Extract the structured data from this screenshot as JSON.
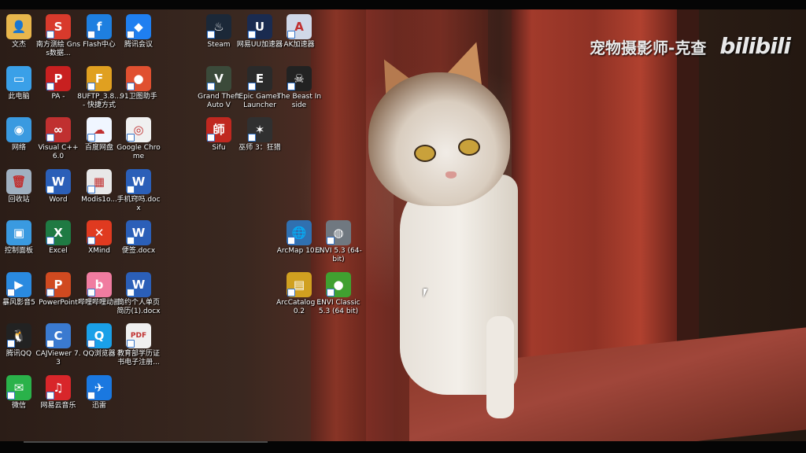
{
  "watermark": {
    "text": "宠物摄影师-克查",
    "logo": "bilibili"
  },
  "icons": [
    {
      "id": "wenjian",
      "label": "文杰",
      "color": "#e8b64c",
      "glyph": "👤",
      "col": 0,
      "row": 0,
      "shortcut": false
    },
    {
      "id": "nanfang",
      "label": "南方测绘 Gnss数据...",
      "color": "#d83a2c",
      "glyph": "S",
      "col": 1,
      "row": 0
    },
    {
      "id": "flash",
      "label": "Flash中心",
      "color": "#1e7fe0",
      "glyph": "f",
      "col": 2,
      "row": 0
    },
    {
      "id": "tengxunhuiyi",
      "label": "腾讯会议",
      "color": "#1f7ff0",
      "glyph": "◆",
      "col": 3,
      "row": 0
    },
    {
      "id": "steam",
      "label": "Steam",
      "color": "#1b2838",
      "glyph": "♨",
      "col": 5,
      "row": 0
    },
    {
      "id": "wangyiuu",
      "label": "网易UU加速器",
      "color": "#1a2b50",
      "glyph": "U",
      "col": 6,
      "row": 0
    },
    {
      "id": "ak",
      "label": "AK加速器",
      "color": "#d0d8e8",
      "glyph": "A",
      "col": 7,
      "row": 0
    },
    {
      "id": "cidiannao",
      "label": "此电脑",
      "color": "#3aa0e8",
      "glyph": "▭",
      "col": 0,
      "row": 1,
      "shortcut": false
    },
    {
      "id": "pa",
      "label": "PA -",
      "color": "#c82020",
      "glyph": "P",
      "col": 1,
      "row": 1
    },
    {
      "id": "8uftp",
      "label": "8UFTP_3.8... - 快捷方式",
      "color": "#e0a020",
      "glyph": "F",
      "col": 2,
      "row": 1
    },
    {
      "id": "91wei",
      "label": "91卫图助手",
      "color": "#e05030",
      "glyph": "●",
      "col": 3,
      "row": 1
    },
    {
      "id": "gta5",
      "label": "Grand Theft Auto V",
      "color": "#3b4a3a",
      "glyph": "V",
      "col": 5,
      "row": 1
    },
    {
      "id": "epic",
      "label": "Epic Games Launcher",
      "color": "#2a2a2a",
      "glyph": "E",
      "col": 6,
      "row": 1
    },
    {
      "id": "beast",
      "label": "The Beast Inside",
      "color": "#222",
      "glyph": "☠",
      "col": 7,
      "row": 1
    },
    {
      "id": "wangluo",
      "label": "网络",
      "color": "#3a9ae0",
      "glyph": "◉",
      "col": 0,
      "row": 2,
      "shortcut": false
    },
    {
      "id": "vc6",
      "label": "Visual C++ 6.0",
      "color": "#c03030",
      "glyph": "∞",
      "col": 1,
      "row": 2
    },
    {
      "id": "baiduyun",
      "label": "百度网盘",
      "color": "#f0f6ff",
      "glyph": "☁",
      "col": 2,
      "row": 2
    },
    {
      "id": "chrome",
      "label": "Google Chrome",
      "color": "#f0f0f0",
      "glyph": "◎",
      "col": 3,
      "row": 2
    },
    {
      "id": "sifu",
      "label": "Sifu",
      "color": "#c02820",
      "glyph": "師",
      "col": 5,
      "row": 2
    },
    {
      "id": "witcher3",
      "label": "巫师 3：狂猎",
      "color": "#303030",
      "glyph": "✶",
      "col": 6,
      "row": 2
    },
    {
      "id": "huishouzhan",
      "label": "回收站",
      "color": "#a0b0c0",
      "glyph": "🗑",
      "col": 0,
      "row": 3,
      "shortcut": false
    },
    {
      "id": "word",
      "label": "Word",
      "color": "#2b5fb8",
      "glyph": "W",
      "col": 1,
      "row": 3
    },
    {
      "id": "modis",
      "label": "Modis1o...",
      "color": "#e8e8e8",
      "glyph": "▦",
      "col": 2,
      "row": 3
    },
    {
      "id": "shoujijiqiao",
      "label": "手机窍吗.docx",
      "color": "#2b5fb8",
      "glyph": "W",
      "col": 3,
      "row": 3
    },
    {
      "id": "kongzhimianban",
      "label": "控制面板",
      "color": "#3a9ae0",
      "glyph": "▣",
      "col": 0,
      "row": 4,
      "shortcut": false
    },
    {
      "id": "excel",
      "label": "Excel",
      "color": "#1f7a43",
      "glyph": "X",
      "col": 1,
      "row": 4
    },
    {
      "id": "xmind",
      "label": "XMind",
      "color": "#e03a20",
      "glyph": "✕",
      "col": 2,
      "row": 4
    },
    {
      "id": "bianqian",
      "label": "便签.docx",
      "color": "#2b5fb8",
      "glyph": "W",
      "col": 3,
      "row": 4
    },
    {
      "id": "arcmap",
      "label": "ArcMap 10.2",
      "color": "#3070b0",
      "glyph": "🌐",
      "col": 7,
      "row": 4
    },
    {
      "id": "envi53",
      "label": "ENVI 5.3 (64-bit)",
      "color": "#707880",
      "glyph": "◍",
      "col": 8,
      "row": 4
    },
    {
      "id": "baofeng",
      "label": "暴风影音5",
      "color": "#2a8ae0",
      "glyph": "▶",
      "col": 0,
      "row": 5
    },
    {
      "id": "powerpoint",
      "label": "PowerPoint",
      "color": "#d04a20",
      "glyph": "P",
      "col": 1,
      "row": 5
    },
    {
      "id": "bilibili",
      "label": "哔哩哔哩动画",
      "color": "#f07ca0",
      "glyph": "b",
      "col": 2,
      "row": 5
    },
    {
      "id": "jianli",
      "label": "简约个人单页简历(1).docx",
      "color": "#2b5fb8",
      "glyph": "W",
      "col": 3,
      "row": 5
    },
    {
      "id": "arccatalog",
      "label": "ArcCatalog 10.2",
      "color": "#d0a020",
      "glyph": "▤",
      "col": 7,
      "row": 5
    },
    {
      "id": "enviclassic",
      "label": "ENVI Classic 5.3 (64 bit)",
      "color": "#40a030",
      "glyph": "●",
      "col": 8,
      "row": 5
    },
    {
      "id": "qq",
      "label": "腾讯QQ",
      "color": "#222",
      "glyph": "🐧",
      "col": 0,
      "row": 6
    },
    {
      "id": "cajviewer",
      "label": "CAJViewer 7.3",
      "color": "#3a7ad0",
      "glyph": "C",
      "col": 1,
      "row": 6
    },
    {
      "id": "qqbrowser",
      "label": "QQ浏览器",
      "color": "#1aa0e8",
      "glyph": "Q",
      "col": 2,
      "row": 6
    },
    {
      "id": "jiaoyubu",
      "label": "教育部学历证书电子注册...",
      "color": "#f0f0f0",
      "glyph": "PDF",
      "col": 3,
      "row": 6
    },
    {
      "id": "weixin",
      "label": "微信",
      "color": "#2ab24a",
      "glyph": "✉",
      "col": 0,
      "row": 7
    },
    {
      "id": "wangyiyun",
      "label": "网易云音乐",
      "color": "#d8262a",
      "glyph": "♫",
      "col": 1,
      "row": 7
    },
    {
      "id": "xunlei",
      "label": "迅雷",
      "color": "#1a78e0",
      "glyph": "✈",
      "col": 2,
      "row": 7
    }
  ]
}
